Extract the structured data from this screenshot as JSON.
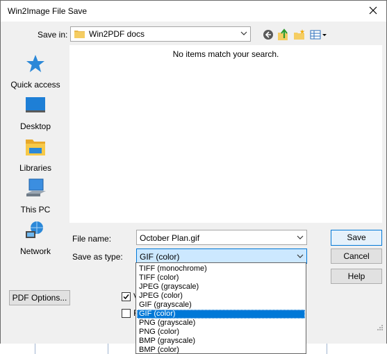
{
  "window": {
    "title": "Win2Image File Save"
  },
  "savein": {
    "label": "Save in:",
    "value": "Win2PDF docs"
  },
  "toolbar": {
    "icons": [
      "back-icon",
      "up-folder-icon",
      "new-folder-icon",
      "views-menu-icon"
    ]
  },
  "places": [
    {
      "label": "Quick access",
      "icon": "quick-access-star-icon"
    },
    {
      "label": "Desktop",
      "icon": "desktop-icon"
    },
    {
      "label": "Libraries",
      "icon": "libraries-icon"
    },
    {
      "label": "This PC",
      "icon": "this-pc-icon"
    },
    {
      "label": "Network",
      "icon": "network-icon"
    }
  ],
  "filelist": {
    "empty_message": "No items match your search."
  },
  "filename": {
    "label": "File name:",
    "value": "October Plan.gif"
  },
  "savetype": {
    "label": "Save as type:",
    "value": "GIF (color)",
    "options": [
      "TIFF (monochrome)",
      "TIFF (color)",
      "JPEG (grayscale)",
      "JPEG (color)",
      "GIF (grayscale)",
      "GIF (color)",
      "PNG (grayscale)",
      "PNG (color)",
      "BMP (grayscale)",
      "BMP (color)"
    ],
    "selected_index": 5
  },
  "buttons": {
    "save": "Save",
    "cancel": "Cancel",
    "help": "Help",
    "pdf_options": "PDF Options..."
  },
  "checkboxes": [
    {
      "label": "V",
      "checked": true
    },
    {
      "label": "F",
      "checked": false
    }
  ],
  "colors": {
    "accent": "#0078d7",
    "selection": "#cce8ff"
  }
}
